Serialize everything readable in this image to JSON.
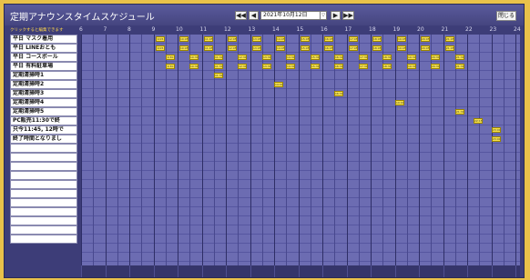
{
  "title": "定期アナウンスタイムスケジュール",
  "nav": {
    "first": "◀◀",
    "prev": "◀",
    "date": "2021年10月12日",
    "date_dropdown": "▽",
    "next": "▶",
    "last": "▶▶"
  },
  "close_label": "閉じる",
  "hint": "クリックすると編集できます",
  "rows": [
    "平日 マスク着用",
    "平日 LINEおとも",
    "平日 コースボール",
    "平日 有料駐車場",
    "定期清掃時1",
    "定期清掃時2",
    "定期清掃時3",
    "定期清掃時4",
    "定期清掃時5",
    "PC販売11:30で終",
    "只今11:45, 12時で",
    "終了時間となりまし",
    "",
    "",
    "",
    "",
    "",
    "",
    "",
    "",
    "",
    "",
    ""
  ],
  "hours": [
    "6",
    "7",
    "8",
    "9",
    "10",
    "11",
    "12",
    "13",
    "14",
    "15",
    "16",
    "17",
    "18",
    "19",
    "20",
    "21",
    "22",
    "23",
    "24"
  ],
  "events": [
    {
      "row": 0,
      "hour": 9,
      "min": 5,
      "label": "9:05"
    },
    {
      "row": 0,
      "hour": 10,
      "min": 5,
      "label": "10:05"
    },
    {
      "row": 0,
      "hour": 11,
      "min": 5,
      "label": "11:05"
    },
    {
      "row": 0,
      "hour": 12,
      "min": 5,
      "label": "12:05"
    },
    {
      "row": 0,
      "hour": 13,
      "min": 5,
      "label": "13:05"
    },
    {
      "row": 0,
      "hour": 14,
      "min": 5,
      "label": "14:05"
    },
    {
      "row": 0,
      "hour": 15,
      "min": 5,
      "label": "15:05"
    },
    {
      "row": 0,
      "hour": 16,
      "min": 5,
      "label": "16:05"
    },
    {
      "row": 0,
      "hour": 17,
      "min": 5,
      "label": "17:05"
    },
    {
      "row": 0,
      "hour": 18,
      "min": 5,
      "label": "18:05"
    },
    {
      "row": 0,
      "hour": 19,
      "min": 5,
      "label": "19:05"
    },
    {
      "row": 0,
      "hour": 20,
      "min": 5,
      "label": "20:05"
    },
    {
      "row": 0,
      "hour": 21,
      "min": 5,
      "label": "21:05"
    },
    {
      "row": 1,
      "hour": 9,
      "min": 5,
      "label": "9:05"
    },
    {
      "row": 1,
      "hour": 10,
      "min": 5,
      "label": "10:05"
    },
    {
      "row": 1,
      "hour": 11,
      "min": 5,
      "label": "11:05"
    },
    {
      "row": 1,
      "hour": 12,
      "min": 5,
      "label": "12:05"
    },
    {
      "row": 1,
      "hour": 13,
      "min": 5,
      "label": "13:05"
    },
    {
      "row": 1,
      "hour": 14,
      "min": 5,
      "label": "14:05"
    },
    {
      "row": 1,
      "hour": 15,
      "min": 5,
      "label": "15:05"
    },
    {
      "row": 1,
      "hour": 16,
      "min": 5,
      "label": "16:05"
    },
    {
      "row": 1,
      "hour": 17,
      "min": 5,
      "label": "17:05"
    },
    {
      "row": 1,
      "hour": 18,
      "min": 5,
      "label": "18:05"
    },
    {
      "row": 1,
      "hour": 19,
      "min": 5,
      "label": "19:05"
    },
    {
      "row": 1,
      "hour": 20,
      "min": 5,
      "label": "20:05"
    },
    {
      "row": 1,
      "hour": 21,
      "min": 5,
      "label": "21:05"
    },
    {
      "row": 2,
      "hour": 9,
      "min": 30,
      "label": "9:30"
    },
    {
      "row": 2,
      "hour": 10,
      "min": 30,
      "label": "10:30"
    },
    {
      "row": 2,
      "hour": 11,
      "min": 30,
      "label": "11:30"
    },
    {
      "row": 2,
      "hour": 12,
      "min": 30,
      "label": "12:30"
    },
    {
      "row": 2,
      "hour": 13,
      "min": 30,
      "label": "13:30"
    },
    {
      "row": 2,
      "hour": 14,
      "min": 30,
      "label": "14:30"
    },
    {
      "row": 2,
      "hour": 15,
      "min": 30,
      "label": "15:30"
    },
    {
      "row": 2,
      "hour": 16,
      "min": 30,
      "label": "16:30"
    },
    {
      "row": 2,
      "hour": 17,
      "min": 30,
      "label": "17:30"
    },
    {
      "row": 2,
      "hour": 18,
      "min": 30,
      "label": "18:30"
    },
    {
      "row": 2,
      "hour": 19,
      "min": 30,
      "label": "19:30"
    },
    {
      "row": 2,
      "hour": 20,
      "min": 30,
      "label": "20:30"
    },
    {
      "row": 2,
      "hour": 21,
      "min": 30,
      "label": "21:30"
    },
    {
      "row": 3,
      "hour": 9,
      "min": 30,
      "label": "9:30"
    },
    {
      "row": 3,
      "hour": 10,
      "min": 30,
      "label": "10:30"
    },
    {
      "row": 3,
      "hour": 11,
      "min": 30,
      "label": "11:30"
    },
    {
      "row": 3,
      "hour": 12,
      "min": 30,
      "label": "12:30"
    },
    {
      "row": 3,
      "hour": 13,
      "min": 30,
      "label": "13:30"
    },
    {
      "row": 3,
      "hour": 14,
      "min": 30,
      "label": "14:30"
    },
    {
      "row": 3,
      "hour": 15,
      "min": 30,
      "label": "15:30"
    },
    {
      "row": 3,
      "hour": 16,
      "min": 30,
      "label": "16:30"
    },
    {
      "row": 3,
      "hour": 17,
      "min": 30,
      "label": "17:30"
    },
    {
      "row": 3,
      "hour": 18,
      "min": 30,
      "label": "18:30"
    },
    {
      "row": 3,
      "hour": 19,
      "min": 30,
      "label": "19:30"
    },
    {
      "row": 3,
      "hour": 20,
      "min": 30,
      "label": "20:30"
    },
    {
      "row": 3,
      "hour": 21,
      "min": 30,
      "label": "21:30"
    },
    {
      "row": 4,
      "hour": 11,
      "min": 30,
      "label": "11:30"
    },
    {
      "row": 5,
      "hour": 14,
      "min": 0,
      "label": "14:00"
    },
    {
      "row": 6,
      "hour": 16,
      "min": 30,
      "label": "16:30"
    },
    {
      "row": 7,
      "hour": 19,
      "min": 0,
      "label": "19:00"
    },
    {
      "row": 8,
      "hour": 21,
      "min": 30,
      "label": "21:30"
    },
    {
      "row": 9,
      "hour": 22,
      "min": 15,
      "label": "22:15"
    },
    {
      "row": 10,
      "hour": 23,
      "min": 0,
      "label": "23:00"
    },
    {
      "row": 11,
      "hour": 23,
      "min": 0,
      "label": "23:00"
    }
  ]
}
